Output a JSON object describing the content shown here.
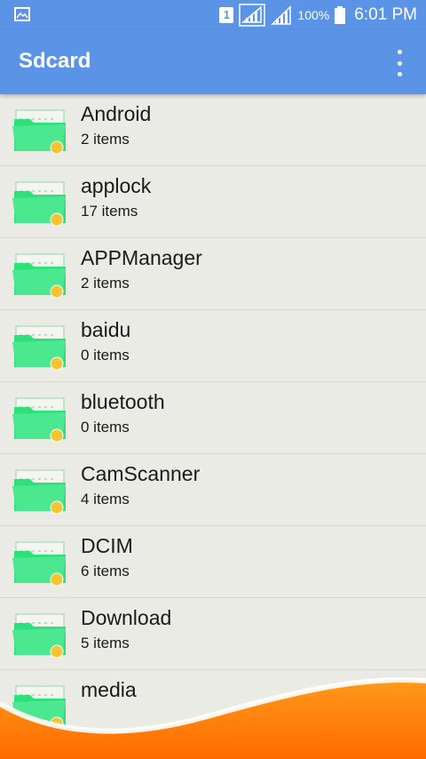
{
  "status_bar": {
    "sim": "1",
    "battery": "100%",
    "time": "6:01 PM"
  },
  "app_bar": {
    "title": "Sdcard"
  },
  "folders": [
    {
      "name": "Android",
      "count": "2 items"
    },
    {
      "name": "applock",
      "count": "17 items"
    },
    {
      "name": "APPManager",
      "count": "2 items"
    },
    {
      "name": "baidu",
      "count": "0 items"
    },
    {
      "name": "bluetooth",
      "count": "0 items"
    },
    {
      "name": "CamScanner",
      "count": "4 items"
    },
    {
      "name": "DCIM",
      "count": "6 items"
    },
    {
      "name": "Download",
      "count": "5 items"
    },
    {
      "name": "media",
      "count": ""
    }
  ],
  "colors": {
    "app_bar": "#5b94e6",
    "folder_green": "#2ee07a",
    "badge_yellow": "#f5c531",
    "wave_orange": "#ff7a00"
  }
}
